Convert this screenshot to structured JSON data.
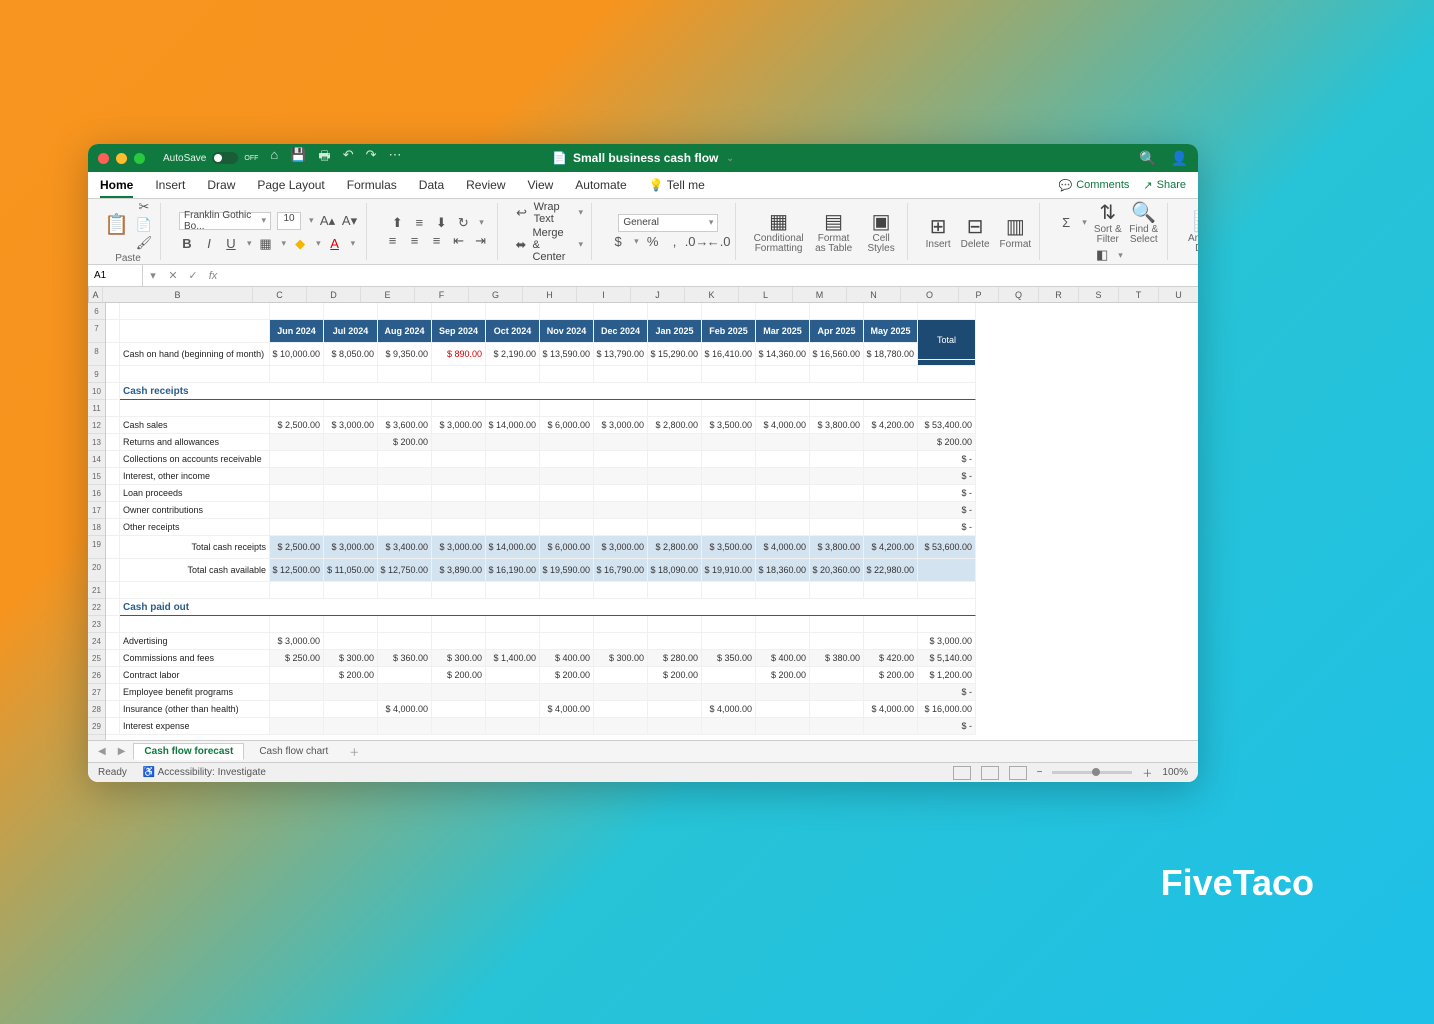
{
  "titlebar": {
    "autosave_label": "AutoSave",
    "autosave_state": "OFF",
    "document_title": "Small business cash flow"
  },
  "ribbon_tabs": [
    "Home",
    "Insert",
    "Draw",
    "Page Layout",
    "Formulas",
    "Data",
    "Review",
    "View",
    "Automate",
    "Tell me"
  ],
  "ribbon_active": "Home",
  "ribbon_right": {
    "comments": "Comments",
    "share": "Share"
  },
  "ribbon": {
    "paste": "Paste",
    "font_name": "Franklin Gothic Bo...",
    "font_size": "10",
    "wrap_text": "Wrap Text",
    "merge_center": "Merge & Center",
    "number_format": "General",
    "cond_fmt": "Conditional Formatting",
    "fmt_table": "Format as Table",
    "cell_styles": "Cell Styles",
    "insert": "Insert",
    "delete": "Delete",
    "format": "Format",
    "sort_filter": "Sort & Filter",
    "find_select": "Find & Select",
    "analyze": "Analyze Data"
  },
  "name_box": "A1",
  "columns": [
    "A",
    "B",
    "C",
    "D",
    "E",
    "F",
    "G",
    "H",
    "I",
    "J",
    "K",
    "L",
    "M",
    "N",
    "O",
    "P",
    "Q",
    "R",
    "S",
    "T",
    "U"
  ],
  "col_widths": {
    "A": 14,
    "B": 150,
    "data": 54,
    "O": 58,
    "narrow": 40
  },
  "row_labels": [
    "6",
    "7",
    "8",
    "9",
    "10",
    "11",
    "12",
    "13",
    "14",
    "15",
    "16",
    "17",
    "18",
    "19",
    "20",
    "21",
    "22",
    "23",
    "24",
    "25",
    "26",
    "27",
    "28",
    "29"
  ],
  "months": [
    "Jun 2024",
    "Jul 2024",
    "Aug 2024",
    "Sep 2024",
    "Oct 2024",
    "Nov 2024",
    "Dec 2024",
    "Jan 2025",
    "Feb 2025",
    "Mar 2025",
    "Apr 2025",
    "May 2025"
  ],
  "total_label": "Total",
  "cash_on_hand": {
    "label": "Cash on hand (beginning of month)",
    "values": [
      "$ 10,000.00",
      "$  8,050.00",
      "$  9,350.00",
      "$     890.00",
      "$  2,190.00",
      "$ 13,590.00",
      "$ 13,790.00",
      "$ 15,290.00",
      "$ 16,410.00",
      "$ 14,360.00",
      "$ 16,560.00",
      "$ 18,780.00"
    ]
  },
  "cash_receipts_header": "Cash receipts",
  "cash_receipts": [
    {
      "label": "Cash sales",
      "v": [
        "$  2,500.00",
        "$  3,000.00",
        "$  3,600.00",
        "$  3,000.00",
        "$ 14,000.00",
        "$  6,000.00",
        "$  3,000.00",
        "$  2,800.00",
        "$  3,500.00",
        "$  4,000.00",
        "$  3,800.00",
        "$  4,200.00"
      ],
      "total": "$  53,400.00"
    },
    {
      "label": "Returns and allowances",
      "v": [
        "",
        "",
        "$     200.00",
        "",
        "",
        "",
        "",
        "",
        "",
        "",
        "",
        ""
      ],
      "total": "$     200.00"
    },
    {
      "label": "Collections on accounts receivable",
      "v": [
        "",
        "",
        "",
        "",
        "",
        "",
        "",
        "",
        "",
        "",
        "",
        ""
      ],
      "total": "$          -"
    },
    {
      "label": "Interest, other income",
      "v": [
        "",
        "",
        "",
        "",
        "",
        "",
        "",
        "",
        "",
        "",
        "",
        ""
      ],
      "total": "$          -"
    },
    {
      "label": "Loan proceeds",
      "v": [
        "",
        "",
        "",
        "",
        "",
        "",
        "",
        "",
        "",
        "",
        "",
        ""
      ],
      "total": "$          -"
    },
    {
      "label": "Owner contributions",
      "v": [
        "",
        "",
        "",
        "",
        "",
        "",
        "",
        "",
        "",
        "",
        "",
        ""
      ],
      "total": "$          -"
    },
    {
      "label": "Other receipts",
      "v": [
        "",
        "",
        "",
        "",
        "",
        "",
        "",
        "",
        "",
        "",
        "",
        ""
      ],
      "total": "$          -"
    }
  ],
  "total_cash_receipts": {
    "label": "Total cash receipts",
    "v": [
      "$  2,500.00",
      "$  3,000.00",
      "$  3,400.00",
      "$  3,000.00",
      "$ 14,000.00",
      "$  6,000.00",
      "$  3,000.00",
      "$  2,800.00",
      "$  3,500.00",
      "$  4,000.00",
      "$  3,800.00",
      "$  4,200.00"
    ],
    "total": "$  53,600.00"
  },
  "total_cash_available": {
    "label": "Total cash available",
    "v": [
      "$ 12,500.00",
      "$ 11,050.00",
      "$ 12,750.00",
      "$  3,890.00",
      "$ 16,190.00",
      "$ 19,590.00",
      "$ 16,790.00",
      "$ 18,090.00",
      "$ 19,910.00",
      "$ 18,360.00",
      "$ 20,360.00",
      "$ 22,980.00"
    ],
    "total": ""
  },
  "cash_paid_header": "Cash paid out",
  "cash_paid": [
    {
      "label": "Advertising",
      "v": [
        "$  3,000.00",
        "",
        "",
        "",
        "",
        "",
        "",
        "",
        "",
        "",
        "",
        ""
      ],
      "total": "$   3,000.00"
    },
    {
      "label": "Commissions and fees",
      "v": [
        "$     250.00",
        "$     300.00",
        "$     360.00",
        "$     300.00",
        "$  1,400.00",
        "$     400.00",
        "$     300.00",
        "$     280.00",
        "$     350.00",
        "$     400.00",
        "$     380.00",
        "$     420.00"
      ],
      "total": "$   5,140.00"
    },
    {
      "label": "Contract labor",
      "v": [
        "",
        "$     200.00",
        "",
        "$     200.00",
        "",
        "$     200.00",
        "",
        "$     200.00",
        "",
        "$     200.00",
        "",
        "$     200.00"
      ],
      "total": "$   1,200.00"
    },
    {
      "label": "Employee benefit programs",
      "v": [
        "",
        "",
        "",
        "",
        "",
        "",
        "",
        "",
        "",
        "",
        "",
        ""
      ],
      "total": "$          -"
    },
    {
      "label": "Insurance (other than health)",
      "v": [
        "",
        "",
        "$  4,000.00",
        "",
        "",
        "$  4,000.00",
        "",
        "",
        "$  4,000.00",
        "",
        "",
        "$  4,000.00"
      ],
      "total": "$  16,000.00"
    },
    {
      "label": "Interest expense",
      "v": [
        "",
        "",
        "",
        "",
        "",
        "",
        "",
        "",
        "",
        "",
        "",
        ""
      ],
      "total": "$          -"
    }
  ],
  "sheet_tabs": [
    "Cash flow forecast",
    "Cash flow chart"
  ],
  "sheet_tab_active": "Cash flow forecast",
  "status": {
    "ready": "Ready",
    "accessibility": "Accessibility: Investigate",
    "zoom": "100%"
  },
  "watermark": "FiveTaco"
}
